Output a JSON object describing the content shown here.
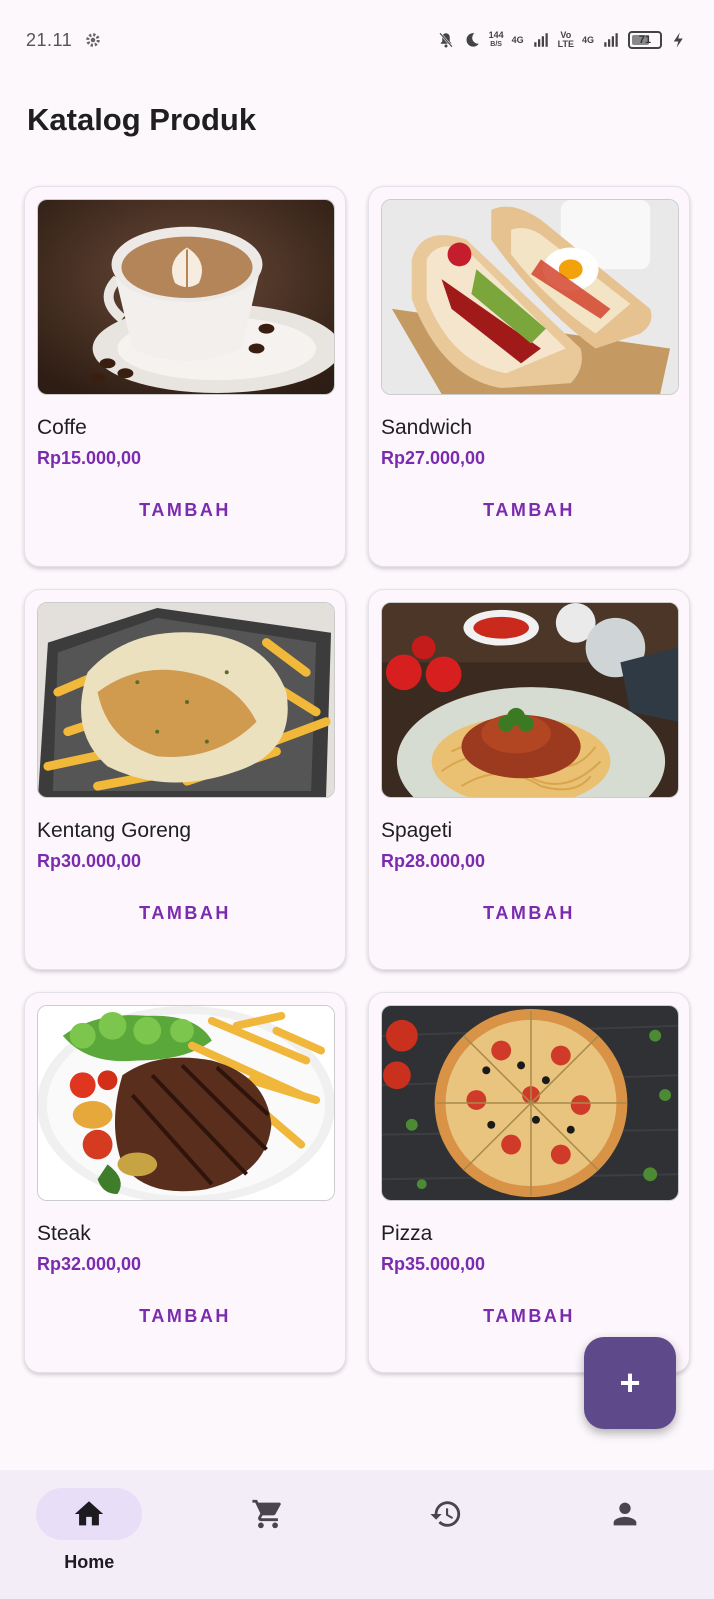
{
  "status_bar": {
    "time": "21.11",
    "speed_top": "144",
    "speed_bottom": "B/S",
    "net1": "4G",
    "volte_top": "Vo",
    "volte_bottom": "LTE",
    "net2": "4G",
    "battery": "71",
    "battery_level": 0.71
  },
  "page": {
    "title": "Katalog Produk"
  },
  "products": [
    {
      "name": "Coffe",
      "price": "Rp15.000,00",
      "button": "TAMBAH"
    },
    {
      "name": "Sandwich",
      "price": "Rp27.000,00",
      "button": "TAMBAH"
    },
    {
      "name": "Kentang Goreng",
      "price": "Rp30.000,00",
      "button": "TAMBAH"
    },
    {
      "name": "Spageti",
      "price": "Rp28.000,00",
      "button": "TAMBAH"
    },
    {
      "name": "Steak",
      "price": "Rp32.000,00",
      "button": "TAMBAH"
    },
    {
      "name": "Pizza",
      "price": "Rp35.000,00",
      "button": "TAMBAH"
    }
  ],
  "fab": {
    "label": "+"
  },
  "nav": {
    "items": [
      {
        "label": "Home",
        "icon": "home-icon",
        "active": true
      },
      {
        "label": "",
        "icon": "cart-icon",
        "active": false
      },
      {
        "label": "",
        "icon": "history-icon",
        "active": false
      },
      {
        "label": "",
        "icon": "person-icon",
        "active": false
      }
    ]
  },
  "colors": {
    "accent": "#7b2cae",
    "fab": "#5e4a8b",
    "nav_active": "#e8def8",
    "background": "#fcf8fc"
  }
}
